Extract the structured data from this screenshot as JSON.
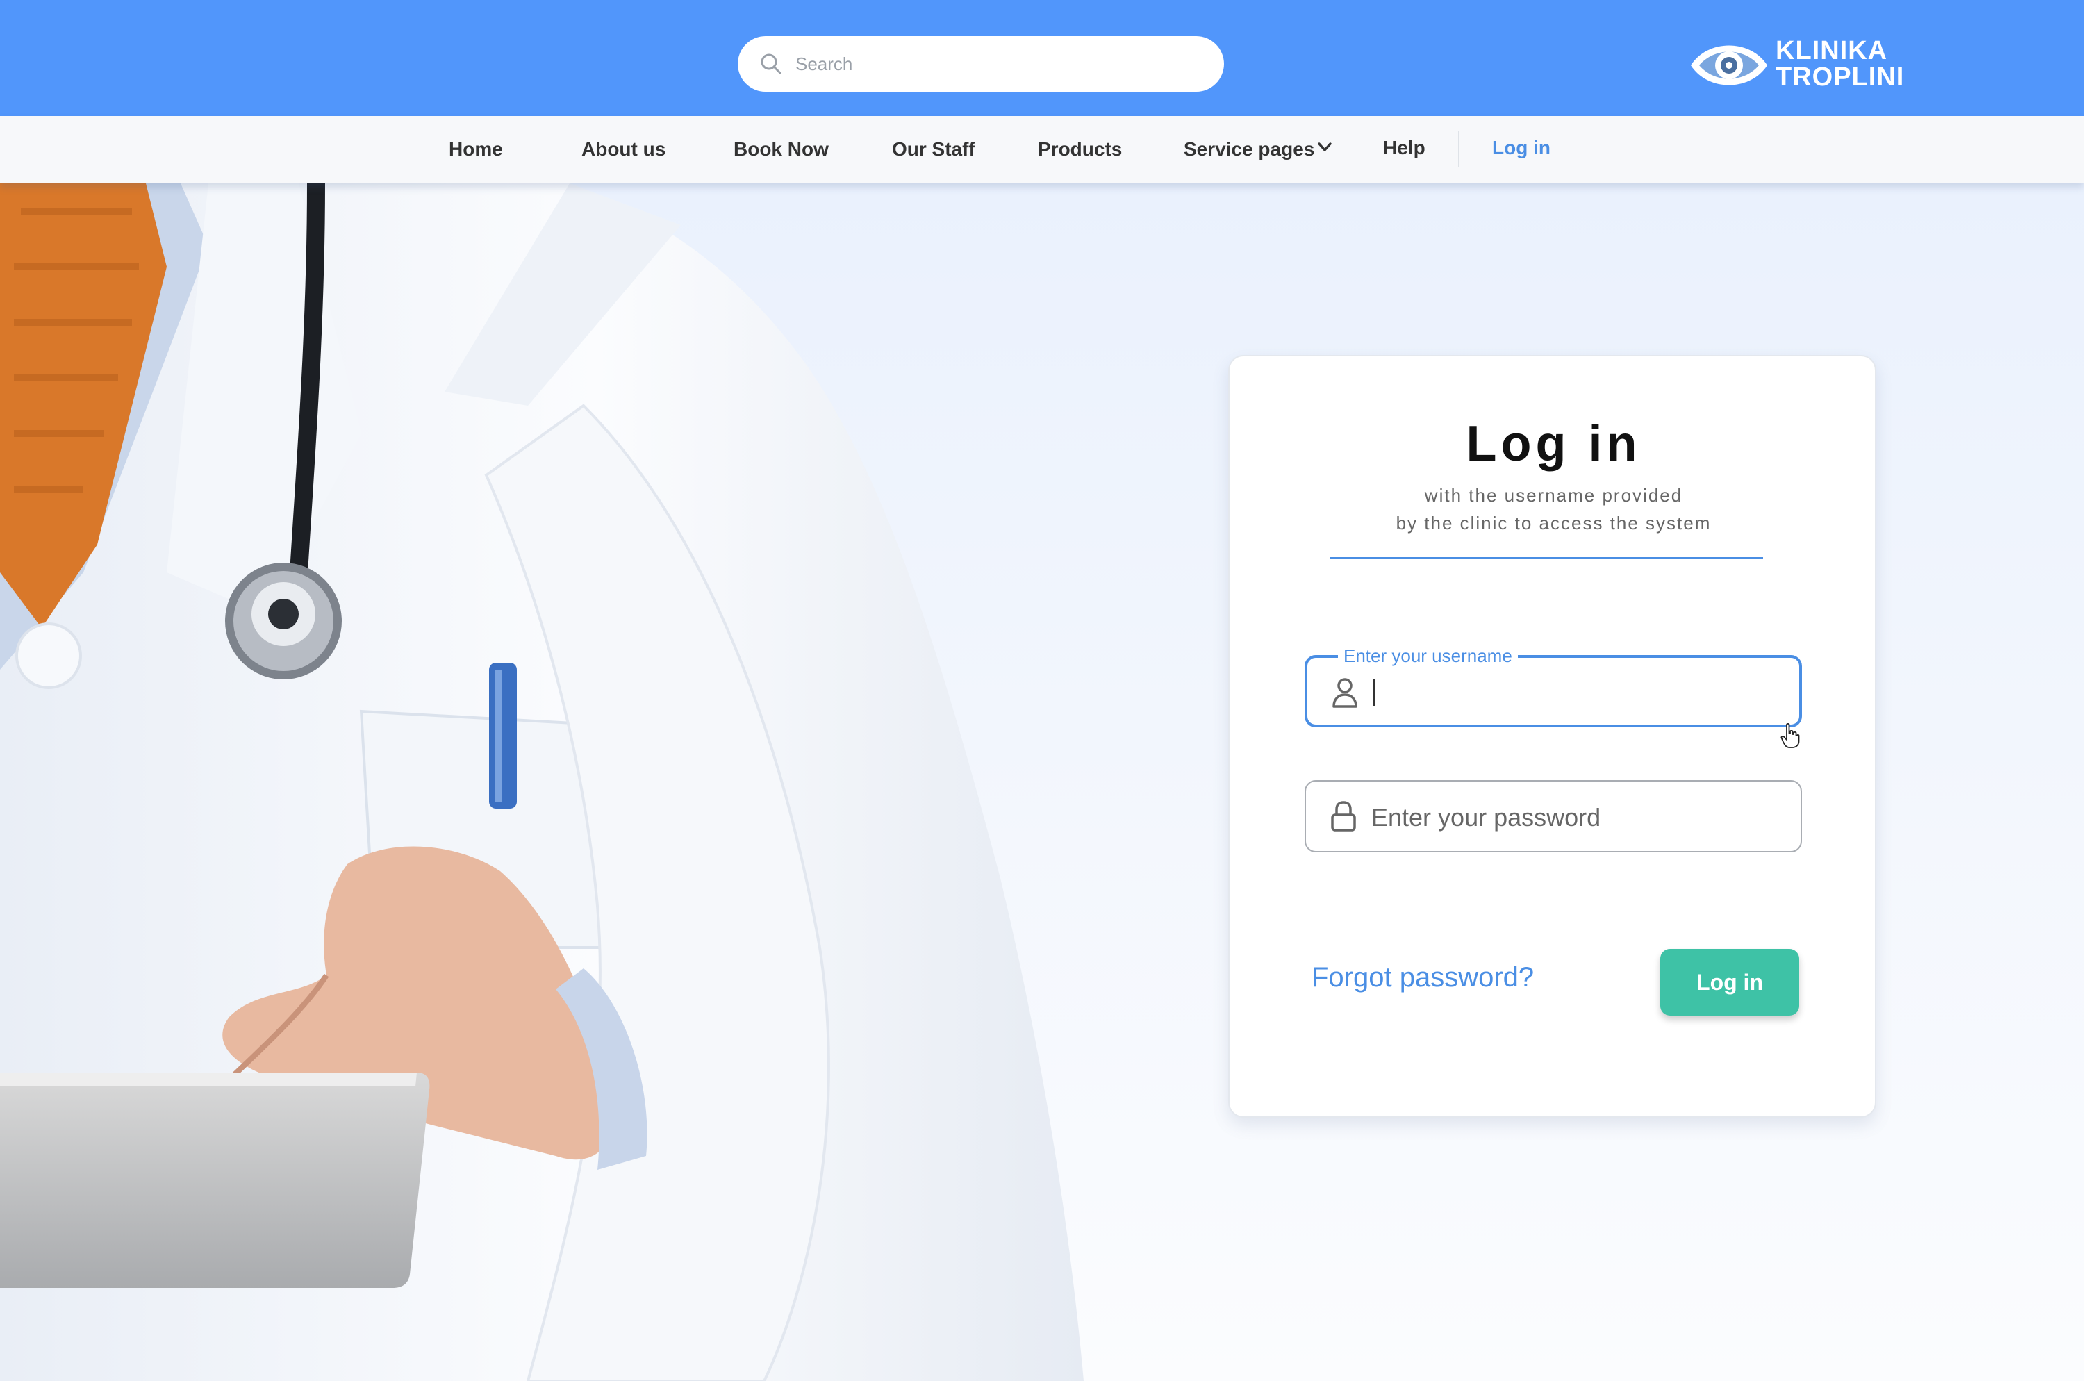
{
  "header": {
    "search": {
      "placeholder": "Search"
    },
    "logo": {
      "line1": "KLINIKA",
      "line2": "TROPLINI"
    }
  },
  "nav": {
    "items": [
      {
        "label": "Home"
      },
      {
        "label": "About us"
      },
      {
        "label": "Book Now"
      },
      {
        "label": "Our Staff"
      },
      {
        "label": "Products"
      },
      {
        "label": "Service pages"
      },
      {
        "label": "Help"
      },
      {
        "label": "Log in"
      }
    ]
  },
  "login_card": {
    "title": "Log in",
    "subtitle_line1": "with the username provided",
    "subtitle_line2": "by the clinic to access the system",
    "username": {
      "label": "Enter your username",
      "value": ""
    },
    "password": {
      "placeholder": "Enter your password"
    },
    "forgot_link": "Forgot password?",
    "submit_label": "Log in"
  },
  "colors": {
    "header_bg": "#5196fb",
    "accent_blue": "#4a8ee4",
    "button_green": "#3ec2a6"
  },
  "icons": [
    "search-icon",
    "eye-logo-icon",
    "chevron-down-icon",
    "user-icon",
    "lock-icon",
    "hand-cursor-icon"
  ]
}
